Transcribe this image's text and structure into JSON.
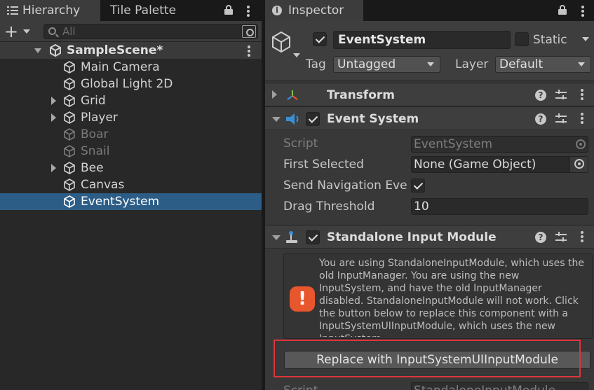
{
  "hierarchy": {
    "tab_label": "Hierarchy",
    "tile_palette_label": "Tile Palette",
    "search_placeholder": "All",
    "scene_name": "SampleScene*",
    "items": [
      {
        "label": "Main Camera",
        "expandable": false,
        "active": true
      },
      {
        "label": "Global Light 2D",
        "expandable": false,
        "active": true
      },
      {
        "label": "Grid",
        "expandable": true,
        "active": true
      },
      {
        "label": "Player",
        "expandable": true,
        "active": true
      },
      {
        "label": "Boar",
        "expandable": false,
        "active": false
      },
      {
        "label": "Snail",
        "expandable": false,
        "active": false
      },
      {
        "label": "Bee",
        "expandable": true,
        "active": true
      },
      {
        "label": "Canvas",
        "expandable": false,
        "active": true
      },
      {
        "label": "EventSystem",
        "expandable": false,
        "active": true,
        "selected": true
      }
    ]
  },
  "inspector": {
    "tab_label": "Inspector",
    "object_name": "EventSystem",
    "static_label": "Static",
    "tag_label": "Tag",
    "tag_value": "Untagged",
    "layer_label": "Layer",
    "layer_value": "Default",
    "components": {
      "transform": {
        "title": "Transform"
      },
      "event_system": {
        "title": "Event System",
        "script_label": "Script",
        "script_value": "EventSystem",
        "first_selected_label": "First Selected",
        "first_selected_value": "None (Game Object)",
        "send_nav_label": "Send Navigation Events",
        "send_nav_checked": true,
        "drag_threshold_label": "Drag Threshold",
        "drag_threshold_value": "10"
      },
      "standalone_input": {
        "title": "Standalone Input Module",
        "warning": "You are using StandaloneInputModule, which uses the old InputManager. You are using the new InputSystem, and have the old InputManager disabled. StandaloneInputModule will not work. Click the button below to replace this component with a InputSystemUIInputModule, which uses the new InputSystem.",
        "replace_button": "Replace with InputSystemUIInputModule",
        "script_label": "Script",
        "script_value": "StandaloneInputModule"
      }
    }
  },
  "colors": {
    "selection": "#2c5d87",
    "warning": "#e8562e",
    "highlight_box": "#e0343b"
  }
}
